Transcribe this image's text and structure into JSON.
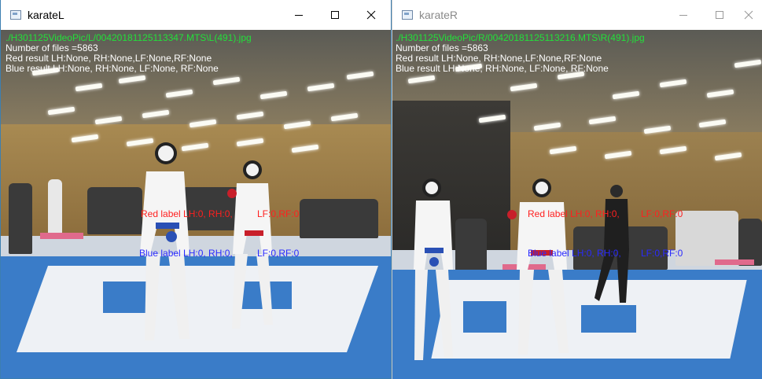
{
  "left": {
    "title": "karateL",
    "path": "./H301125VideoPic/L/00420181125113347.MTS\\L(491).jpg",
    "file_count": "Number of files =5863",
    "red_result": "Red result LH:None, RH:None,LF:None,RF:None",
    "blue_result": "Blue result LH:None, RH:None, LF:None, RF:None",
    "red_label_a": "Red label LH:0, RH:0,",
    "red_label_b": "LF:0,RF:0",
    "blue_label_a": "Blue label LH:0, RH:0,",
    "blue_label_b": "LF:0,RF:0"
  },
  "right": {
    "title": "karateR",
    "path": "./H301125VideoPic/R/00420181125113216.MTS\\R(491).jpg",
    "file_count": "Number of files =5863",
    "red_result": "Red result LH:None, RH:None,LF:None,RF:None",
    "blue_result": "Blue result LH:None, RH:None, LF:None, RF:None",
    "red_label_a": "Red label LH:0, RH:0,",
    "red_label_b": "LF:0,RF:0",
    "blue_label_a": "Blue label LH:0, RH:0,",
    "blue_label_b": "LF:0,RF:0"
  },
  "controls": {
    "minimize": "minimize-icon",
    "maximize": "maximize-icon",
    "close": "close-icon"
  }
}
